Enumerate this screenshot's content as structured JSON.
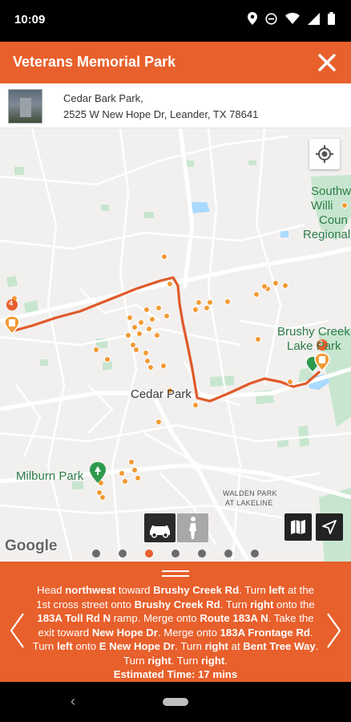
{
  "status_bar": {
    "time": "10:09"
  },
  "header": {
    "title": "Veterans Memorial Park"
  },
  "address": {
    "name": "Cedar Bark Park,",
    "street": "2525 W New Hope Dr, Leander, TX 78641"
  },
  "map": {
    "labels": {
      "southwest": "Southw",
      "williamson": "Willi",
      "county": "Coun",
      "regional": "Regional",
      "brushy_creek": "Brushy Creek",
      "lake_park": "Lake Park",
      "cedar_park": "Cedar Park",
      "milburn_park": "Milburn Park",
      "walden_park": "WALDEN PARK",
      "at_lakeline": "AT LAKELINE",
      "google": "Google",
      "marker_4": "4",
      "marker_3": "3"
    },
    "page_count": 7,
    "active_page": 3
  },
  "directions": {
    "segments": [
      {
        "t": "Head ",
        "b": false
      },
      {
        "t": "northwest",
        "b": true
      },
      {
        "t": " toward ",
        "b": false
      },
      {
        "t": "Brushy Creek Rd",
        "b": true
      },
      {
        "t": ". Turn ",
        "b": false
      },
      {
        "t": "left",
        "b": true
      },
      {
        "t": " at the 1st cross street onto ",
        "b": false
      },
      {
        "t": "Brushy Creek Rd",
        "b": true
      },
      {
        "t": ". Turn ",
        "b": false
      },
      {
        "t": "right",
        "b": true
      },
      {
        "t": " onto the ",
        "b": false
      },
      {
        "t": "183A Toll Rd N",
        "b": true
      },
      {
        "t": " ramp. Merge onto ",
        "b": false
      },
      {
        "t": "Route 183A N",
        "b": true
      },
      {
        "t": ". Take the exit toward ",
        "b": false
      },
      {
        "t": "New Hope Dr",
        "b": true
      },
      {
        "t": ". Merge onto ",
        "b": false
      },
      {
        "t": "183A Frontage Rd",
        "b": true
      },
      {
        "t": ". Turn ",
        "b": false
      },
      {
        "t": "left",
        "b": true
      },
      {
        "t": " onto ",
        "b": false
      },
      {
        "t": "E New Hope Dr",
        "b": true
      },
      {
        "t": ". Turn ",
        "b": false
      },
      {
        "t": "right",
        "b": true
      },
      {
        "t": " at ",
        "b": false
      },
      {
        "t": "Bent Tree Way",
        "b": true
      },
      {
        "t": ". Turn ",
        "b": false
      },
      {
        "t": "right",
        "b": true
      },
      {
        "t": ". Turn ",
        "b": false
      },
      {
        "t": "right",
        "b": true
      },
      {
        "t": ".",
        "b": false
      }
    ],
    "estimated_label": "Estimated Time: 17 mins"
  },
  "colors": {
    "accent": "#e8602c",
    "route": "#e05a2a",
    "park_green": "#2e9a4e",
    "poi": "#f29a34"
  },
  "icons": {
    "close": "close-icon",
    "locate": "crosshair-icon",
    "car": "car-icon",
    "walk": "walking-person-icon",
    "map_type": "map-icon",
    "navigate": "navigation-arrow-icon",
    "prev": "chevron-left-icon",
    "next": "chevron-right-icon"
  }
}
